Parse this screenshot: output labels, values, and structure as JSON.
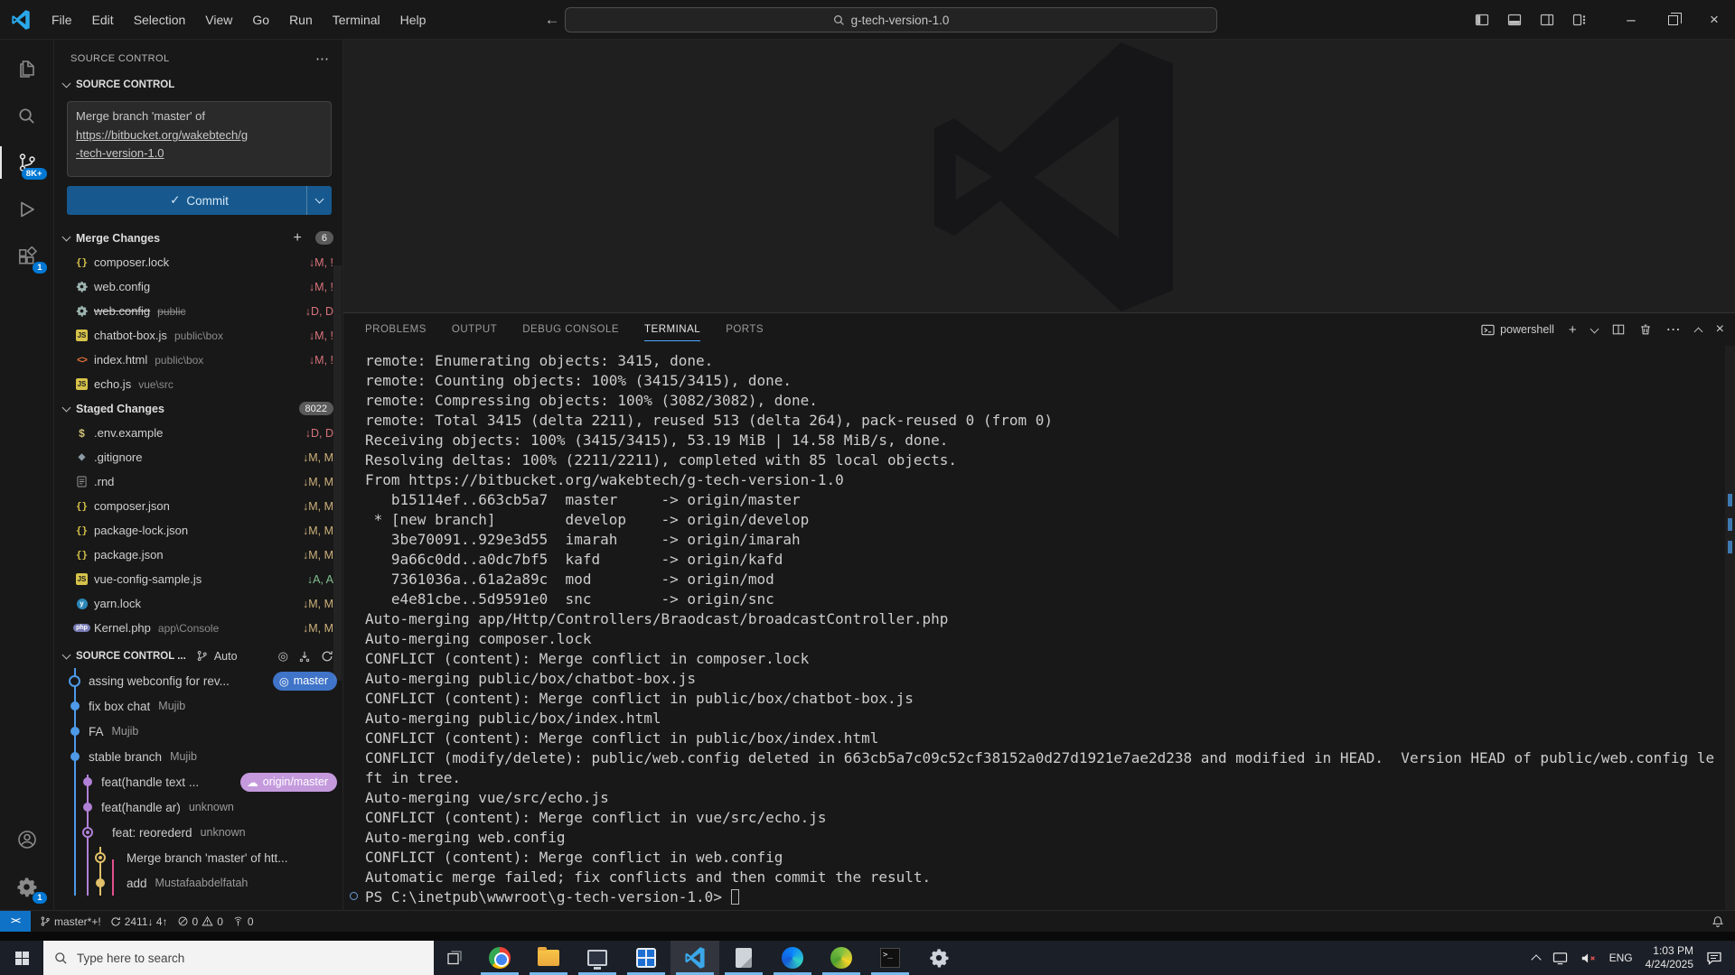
{
  "titlebar": {
    "menu": [
      "File",
      "Edit",
      "Selection",
      "View",
      "Go",
      "Run",
      "Terminal",
      "Help"
    ],
    "search_value": "g-tech-version-1.0"
  },
  "activity_bar": {
    "scm_badge": "8K+",
    "extensions_badge": "1",
    "settings_badge": "1"
  },
  "sidebar": {
    "panel_title": "SOURCE CONTROL",
    "panel_more": "⋯",
    "scm_section_title": "SOURCE CONTROL",
    "commit_message": [
      "Merge branch 'master' of",
      "https://bitbucket.org/wakebtech/g",
      "-tech-version-1.0"
    ],
    "commit_button_label": "Commit",
    "commit_check": "✓",
    "merge_changes": {
      "label": "Merge Changes",
      "badge": "6",
      "files": [
        {
          "icon": "json-icon",
          "name": "composer.lock",
          "desc": "",
          "status": "↓M, !",
          "status_type": "conflict",
          "strike": false
        },
        {
          "icon": "gear-icon",
          "name": "web.config",
          "desc": "",
          "status": "↓M, !",
          "status_type": "conflict",
          "strike": false
        },
        {
          "icon": "gear-icon",
          "name": "web.config",
          "desc": "public",
          "status": "↓D, D",
          "status_type": "deleted",
          "strike": true
        },
        {
          "icon": "js-icon",
          "name": "chatbot-box.js",
          "desc": "public\\box",
          "status": "↓M, !",
          "status_type": "conflict",
          "strike": false
        },
        {
          "icon": "html-icon",
          "name": "index.html",
          "desc": "public\\box",
          "status": "↓M, !",
          "status_type": "conflict",
          "strike": false
        },
        {
          "icon": "js-icon",
          "name": "echo.js",
          "desc": "vue\\src",
          "status": "",
          "status_type": "none",
          "strike": false
        }
      ]
    },
    "staged_changes": {
      "label": "Staged Changes",
      "badge": "8022",
      "files": [
        {
          "icon": "env-icon",
          "name": ".env.example",
          "desc": "",
          "status": "↓D, D",
          "status_type": "deleted",
          "strike": false
        },
        {
          "icon": "git-icon",
          "name": ".gitignore",
          "desc": "",
          "status": "↓M, M",
          "status_type": "modified",
          "strike": false
        },
        {
          "icon": "file-icon",
          "name": ".rnd",
          "desc": "",
          "status": "↓M, M",
          "status_type": "modified",
          "strike": false
        },
        {
          "icon": "json-icon",
          "name": "composer.json",
          "desc": "",
          "status": "↓M, M",
          "status_type": "modified",
          "strike": false
        },
        {
          "icon": "json-icon",
          "name": "package-lock.json",
          "desc": "",
          "status": "↓M, M",
          "status_type": "modified",
          "strike": false
        },
        {
          "icon": "json-icon",
          "name": "package.json",
          "desc": "",
          "status": "↓M, M",
          "status_type": "modified",
          "strike": false
        },
        {
          "icon": "js-icon",
          "name": "vue-config-sample.js",
          "desc": "",
          "status": "↓A, A",
          "status_type": "added",
          "strike": false
        },
        {
          "icon": "yarn-icon",
          "name": "yarn.lock",
          "desc": "",
          "status": "↓M, M",
          "status_type": "modified",
          "strike": false
        },
        {
          "icon": "php-icon",
          "name": "Kernel.php",
          "desc": "app\\Console",
          "status": "↓M, M",
          "status_type": "modified",
          "strike": false
        }
      ]
    },
    "graph": {
      "section_title": "SOURCE CONTROL ...",
      "auto_label": "Auto",
      "commits": [
        {
          "message": "assing webconfig for rev...",
          "author": "",
          "badge": "master",
          "badge_style": "blue",
          "badge_icon": "◎",
          "node": "open",
          "col": 1,
          "color": "blue"
        },
        {
          "message": "fix box chat",
          "author": "Mujib",
          "badge": "",
          "node": "dot",
          "col": 1,
          "color": "blue"
        },
        {
          "message": "FA",
          "author": "Mujib",
          "badge": "",
          "node": "dot",
          "col": 1,
          "color": "blue"
        },
        {
          "message": "stable branch",
          "author": "Mujib",
          "badge": "",
          "node": "dot",
          "col": 1,
          "color": "blue"
        },
        {
          "message": "feat(handle text ...",
          "author": "",
          "badge": "origin/master",
          "badge_style": "purple",
          "badge_icon": "☁",
          "node": "dot",
          "col": 2,
          "color": "purple"
        },
        {
          "message": "feat(handle ar)",
          "author": "unknown",
          "badge": "",
          "node": "dot",
          "col": 2,
          "color": "purple"
        },
        {
          "message": "feat: reorederd",
          "author": "unknown",
          "badge": "",
          "node": "ring",
          "col": 2,
          "color": "purple"
        },
        {
          "message": "Merge branch 'master' of htt...",
          "author": "",
          "badge": "",
          "node": "ring",
          "col": 3,
          "color": "yellow"
        },
        {
          "message": "add",
          "author": "Mustafaabdelfatah",
          "badge": "",
          "node": "dot",
          "col": 3,
          "color": "yellow"
        }
      ]
    }
  },
  "panel": {
    "tabs": [
      "PROBLEMS",
      "OUTPUT",
      "DEBUG CONSOLE",
      "TERMINAL",
      "PORTS"
    ],
    "active_tab": "TERMINAL",
    "shell_label": "powershell",
    "terminal_lines": [
      "remote: Enumerating objects: 3415, done.",
      "remote: Counting objects: 100% (3415/3415), done.",
      "remote: Compressing objects: 100% (3082/3082), done.",
      "remote: Total 3415 (delta 2211), reused 513 (delta 264), pack-reused 0 (from 0)",
      "Receiving objects: 100% (3415/3415), 53.19 MiB | 14.58 MiB/s, done.",
      "Resolving deltas: 100% (2211/2211), completed with 85 local objects.",
      "From https://bitbucket.org/wakebtech/g-tech-version-1.0",
      "   b15114ef..663cb5a7  master     -> origin/master",
      " * [new branch]        develop    -> origin/develop",
      "   3be70091..929e3d55  imarah     -> origin/imarah",
      "   9a66c0dd..a0dc7bf5  kafd       -> origin/kafd",
      "   7361036a..61a2a89c  mod        -> origin/mod",
      "   e4e81cbe..5d9591e0  snc        -> origin/snc",
      "Auto-merging app/Http/Controllers/Braodcast/broadcastController.php",
      "Auto-merging composer.lock",
      "CONFLICT (content): Merge conflict in composer.lock",
      "Auto-merging public/box/chatbot-box.js",
      "CONFLICT (content): Merge conflict in public/box/chatbot-box.js",
      "Auto-merging public/box/index.html",
      "CONFLICT (content): Merge conflict in public/box/index.html",
      "CONFLICT (modify/delete): public/web.config deleted in 663cb5a7c09c52cf38152a0d27d1921e7ae2d238 and modified in HEAD.  Version HEAD of public/web.config le",
      "ft in tree.",
      "Auto-merging vue/src/echo.js",
      "CONFLICT (content): Merge conflict in vue/src/echo.js",
      "Auto-merging web.config",
      "CONFLICT (content): Merge conflict in web.config",
      "Automatic merge failed; fix conflicts and then commit the result."
    ],
    "prompt": "PS C:\\inetpub\\wwwroot\\g-tech-version-1.0> "
  },
  "status_bar": {
    "remote_indicator": "><",
    "branch": "master*+!",
    "sync": "2411↓ 4↑",
    "errors": "0",
    "warnings": "0",
    "ports": "0"
  },
  "taskbar": {
    "search_placeholder": "Type here to search",
    "apps": [
      "chrome",
      "file-explorer",
      "computer",
      "mail-grid",
      "vscode",
      "notepad",
      "browser",
      "color-app",
      "terminal",
      "settings"
    ],
    "tray": {
      "language": "ENG",
      "time": "1:03 PM",
      "date": "4/24/2025"
    }
  },
  "colors": {
    "accent": "#0078d4",
    "conflict": "#d8737b",
    "modified": "#cdb17c",
    "added": "#82c08f",
    "graph_blue": "#4e9ae8",
    "graph_purple": "#b180d7",
    "graph_yellow": "#e0c06a",
    "graph_pink": "#e1508e"
  }
}
